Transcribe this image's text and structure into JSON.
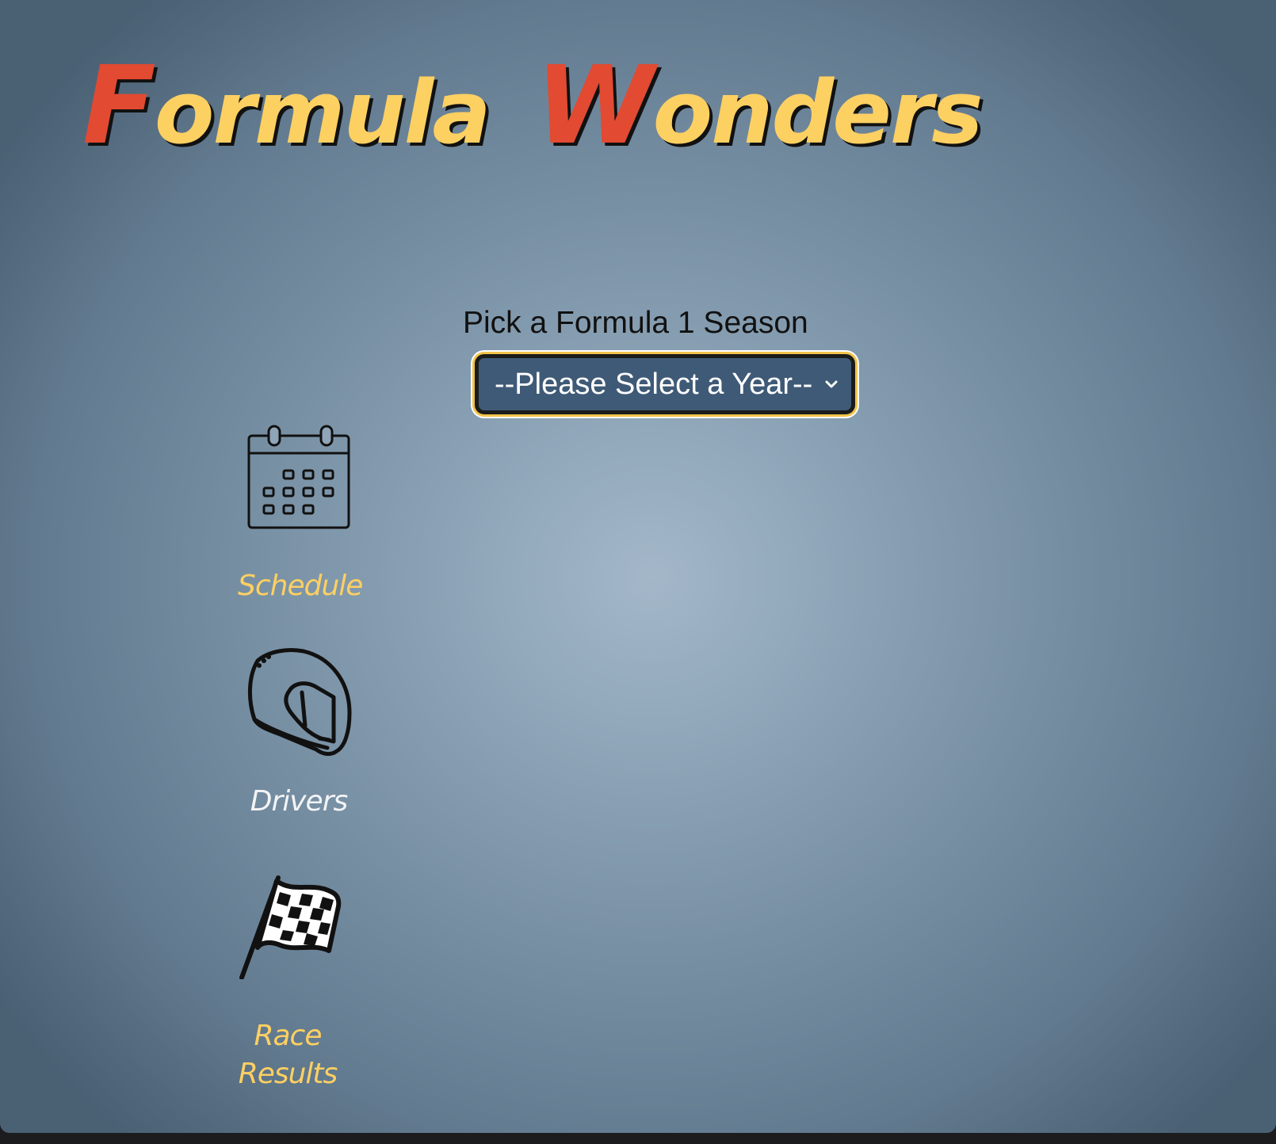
{
  "header": {
    "logo_first_cap": "F",
    "logo_first_rest": "ormula",
    "logo_second_cap": "W",
    "logo_second_rest": "onders"
  },
  "season": {
    "label": "Pick a Formula 1 Season",
    "selected": "--Please Select a Year--"
  },
  "nav": {
    "items": [
      {
        "label": "Schedule",
        "icon": "calendar-icon",
        "color": "#fdd062"
      },
      {
        "label": "Drivers",
        "icon": "helmet-icon",
        "color": "#f2f4f6"
      },
      {
        "label_line1": "Race",
        "label_line2": "Results",
        "icon": "checkered-flag-icon",
        "color": "#fdd062"
      }
    ]
  },
  "colors": {
    "logo_accent": "#e24a32",
    "logo_main": "#fdd062",
    "select_background": "#3f5a76",
    "select_outline": "#f2c34b"
  }
}
